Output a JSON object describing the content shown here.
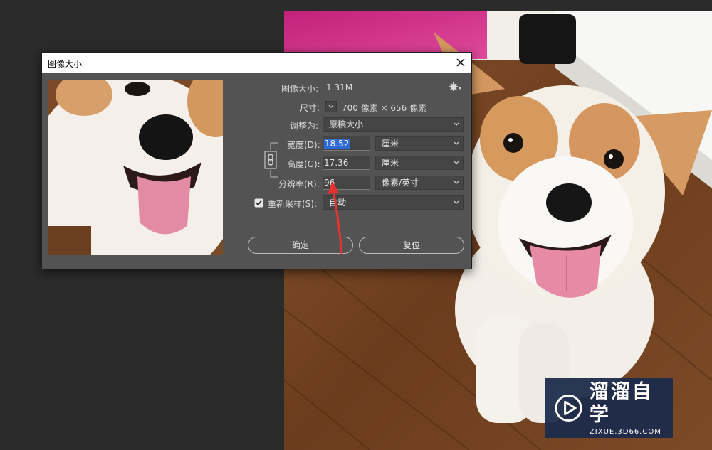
{
  "dialog": {
    "title": "图像大小",
    "image_size_label": "图像大小:",
    "image_size_value": "1.31M",
    "dimensions_label": "尺寸:",
    "dimensions_value": "700 像素 × 656 像素",
    "fit_to_label": "调整为:",
    "fit_to_value": "原稿大小",
    "width_label": "宽度(D):",
    "width_value": "18.52",
    "width_unit": "厘米",
    "height_label": "高度(G):",
    "height_value": "17.36",
    "height_unit": "厘米",
    "resolution_label": "分辨率(R):",
    "resolution_value": "96",
    "resolution_unit": "像素/英寸",
    "resample_label": "重新采样(S):",
    "resample_checked": true,
    "resample_value": "自动",
    "ok_label": "确定",
    "reset_label": "复位"
  },
  "watermark": {
    "title": "溜溜自学",
    "url": "ZIXUE.3D66.COM"
  },
  "colors": {
    "app_background": "#2b2b2b",
    "dialog_background": "#535353",
    "field_background": "#454545",
    "selection": "#2f6bd6",
    "arrow": "#e8322f",
    "watermark_bg": "#1c2c4a"
  },
  "icons": [
    "gear-icon",
    "close-icon",
    "chain-link-icon",
    "chevron-down-icon",
    "checkbox-icon",
    "play-logo-icon"
  ]
}
